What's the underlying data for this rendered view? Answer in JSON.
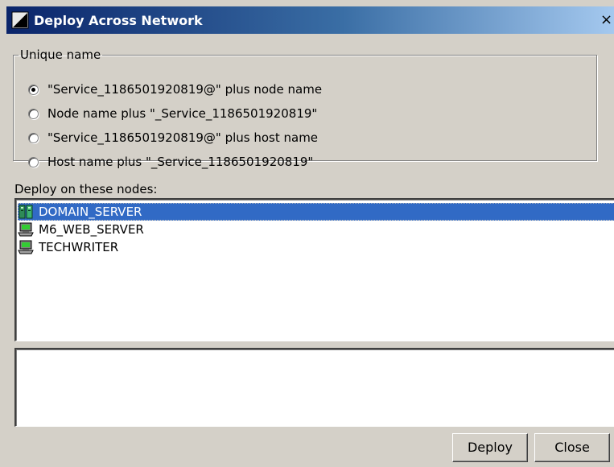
{
  "window": {
    "title": "Deploy Across Network",
    "close_glyph": "×",
    "icon": "deploy-app-icon"
  },
  "unique_name": {
    "legend": "Unique name",
    "options": [
      {
        "label": "\"Service_1186501920819@\" plus node name",
        "checked": true
      },
      {
        "label": "Node name plus \"_Service_1186501920819\"",
        "checked": false
      },
      {
        "label": "\"Service_1186501920819@\" plus host name",
        "checked": false
      },
      {
        "label": "Host name plus \"_Service_1186501920819\"",
        "checked": false
      }
    ]
  },
  "nodes": {
    "label": "Deploy on these nodes:",
    "items": [
      {
        "name": "DOMAIN_SERVER",
        "icon": "domain-server-icon",
        "selected": true
      },
      {
        "name": "M6_WEB_SERVER",
        "icon": "computer-node-icon",
        "selected": false
      },
      {
        "name": "TECHWRITER",
        "icon": "computer-node-icon",
        "selected": false
      }
    ]
  },
  "output": {
    "value": ""
  },
  "buttons": {
    "deploy": "Deploy",
    "close": "Close"
  },
  "colors": {
    "titlebar_start": "#0a246a",
    "titlebar_end": "#a6caf0",
    "selection": "#316ac5",
    "dialog_bg": "#d4d0c8"
  }
}
